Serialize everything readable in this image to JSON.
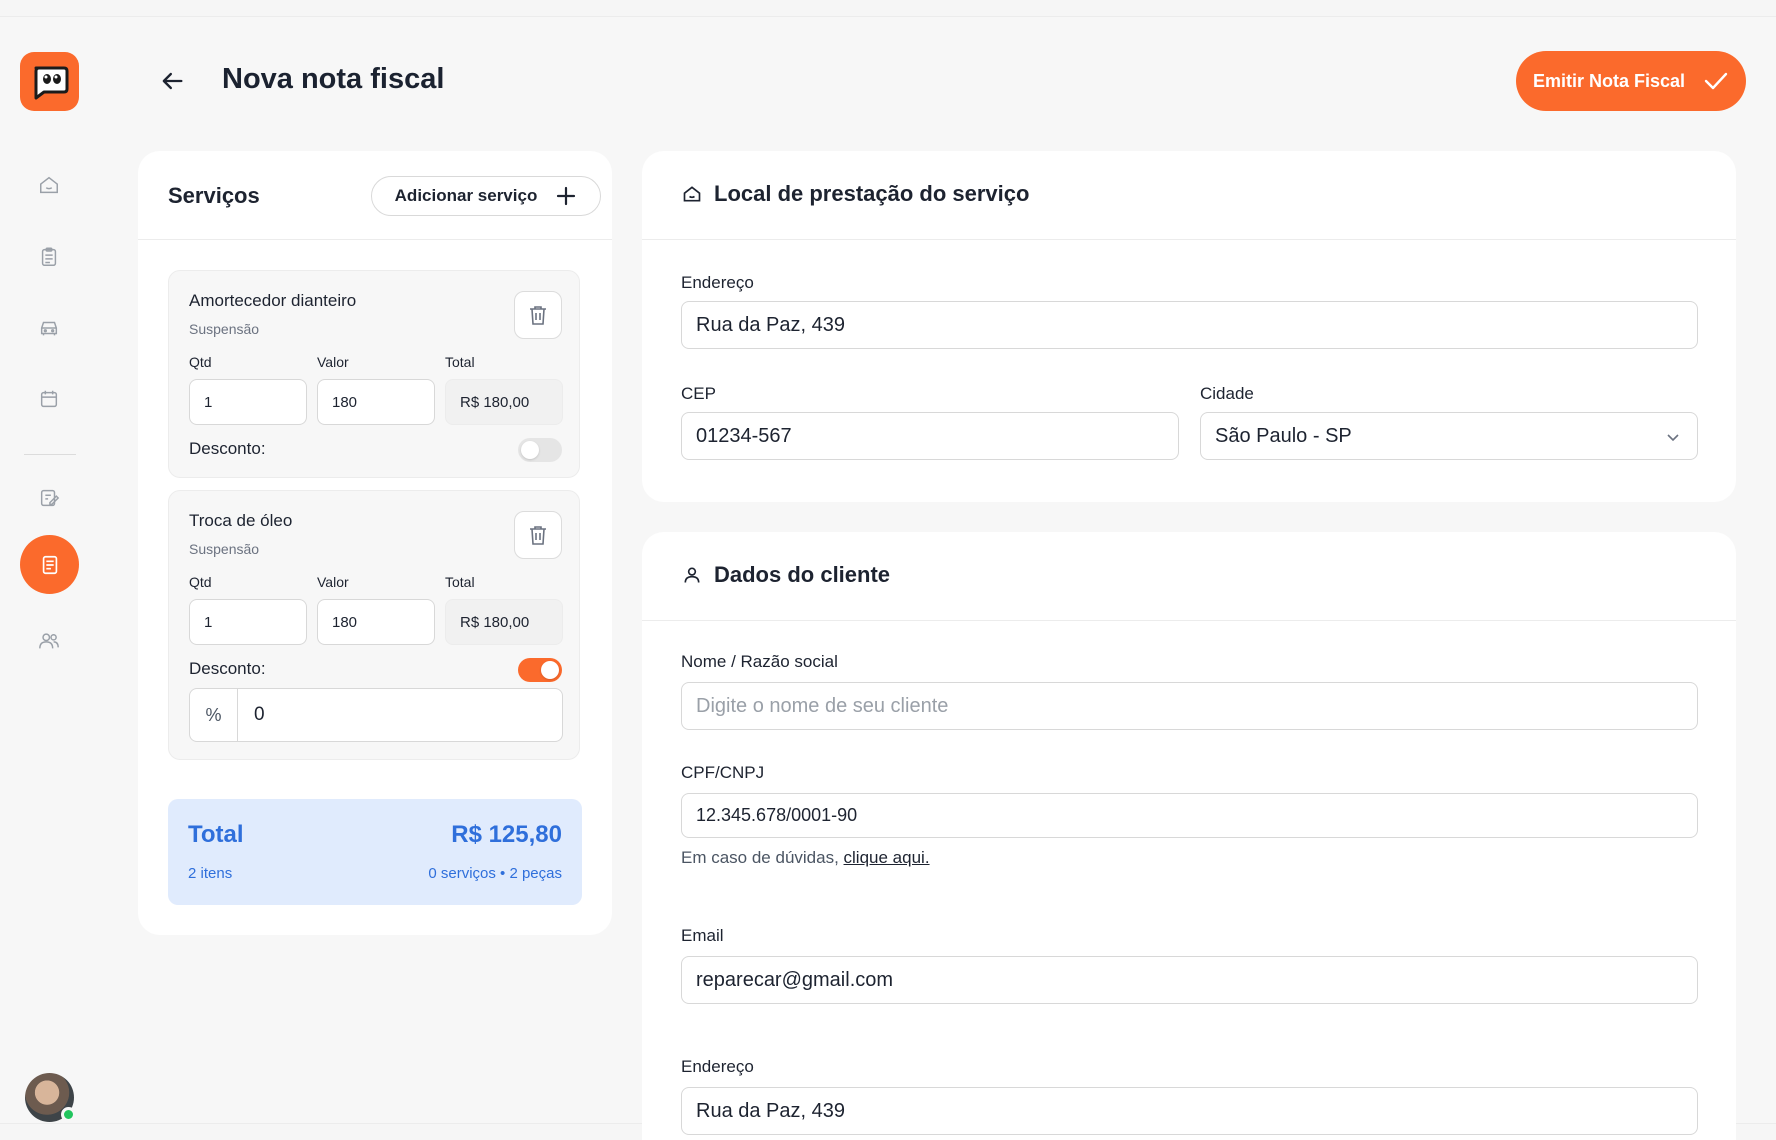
{
  "header": {
    "title": "Nova nota fiscal",
    "emit_button": "Emitir Nota Fiscal"
  },
  "sidebar": {
    "items": [
      {
        "name": "home",
        "icon": "home-icon"
      },
      {
        "name": "clipboard",
        "icon": "clipboard-icon"
      },
      {
        "name": "car",
        "icon": "car-icon"
      },
      {
        "name": "calendar",
        "icon": "calendar-icon"
      },
      {
        "name": "edit",
        "icon": "edit-document-icon"
      },
      {
        "name": "invoice",
        "icon": "invoice-icon",
        "active": true
      },
      {
        "name": "users",
        "icon": "users-icon"
      }
    ]
  },
  "services": {
    "title": "Serviços",
    "add_button": "Adicionar serviço",
    "items": [
      {
        "name": "Amortecedor dianteiro",
        "category": "Suspensão",
        "qtd_label": "Qtd",
        "valor_label": "Valor",
        "total_label": "Total",
        "qtd": "1",
        "valor": "180",
        "total": "R$ 180,00",
        "discount_label": "Desconto:",
        "discount_enabled": false
      },
      {
        "name": "Troca de óleo",
        "category": "Suspensão",
        "qtd_label": "Qtd",
        "valor_label": "Valor",
        "total_label": "Total",
        "qtd": "1",
        "valor": "180",
        "total": "R$ 180,00",
        "discount_label": "Desconto:",
        "discount_enabled": true,
        "discount_unit": "%",
        "discount_value": "0"
      }
    ],
    "summary": {
      "label": "Total",
      "value": "R$ 125,80",
      "items": "2 itens",
      "breakdown": "0 serviços • 2 peças"
    }
  },
  "location": {
    "title": "Local de prestação do serviço",
    "address_label": "Endereço",
    "address": "Rua da Paz, 439",
    "cep_label": "CEP",
    "cep": "01234-567",
    "city_label": "Cidade",
    "city": "São Paulo - SP"
  },
  "client": {
    "title": "Dados do cliente",
    "name_label": "Nome / Razão social",
    "name_placeholder": "Digite o nome de seu cliente",
    "doc_label": "CPF/CNPJ",
    "doc": "12.345.678/0001-90",
    "help_text": "Em caso de dúvidas, ",
    "help_link": "clique aqui.",
    "email_label": "Email",
    "email": "reparecar@gmail.com",
    "address_label": "Endereço",
    "address": "Rua da Paz, 439"
  },
  "colors": {
    "accent": "#fb6a2c",
    "total_bg": "#e0ebfd",
    "total_text": "#2f6fdb",
    "online": "#22c55e"
  }
}
